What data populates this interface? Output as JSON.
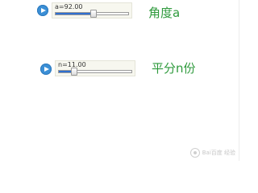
{
  "sliders": [
    {
      "label": "a=92.00",
      "caption": "角度a",
      "position_fraction": 0.52
    },
    {
      "label": "n=11.00",
      "caption": "平分n份",
      "position_fraction": 0.21
    }
  ],
  "watermark": {
    "text": "Bai百度 经验",
    "icon": "paw-icon"
  },
  "colors": {
    "caption": "#2e9a3c",
    "play_button": "#3b8fd6",
    "slider_fill": "#2f6fd0"
  }
}
